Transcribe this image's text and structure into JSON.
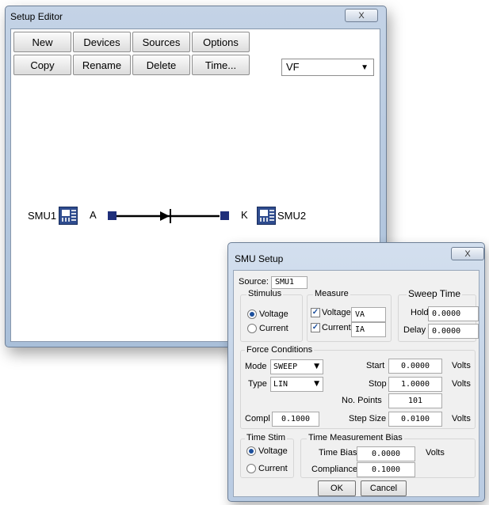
{
  "setup_editor": {
    "title": "Setup Editor",
    "close_glyph": "X",
    "toolbar_row1": [
      "New",
      "Devices",
      "Sources",
      "Options"
    ],
    "toolbar_row2": [
      "Copy",
      "Rename",
      "Delete",
      "Time..."
    ],
    "setup_select": {
      "value": "VF",
      "arrow": "▼"
    },
    "diagram": {
      "left_smu": "SMU1",
      "right_smu": "SMU2",
      "anode_label": "A",
      "cathode_label": "K"
    }
  },
  "smu_setup": {
    "title": "SMU Setup",
    "close_glyph": "X",
    "source_label": "Source:",
    "source_value": "SMU1",
    "stimulus": {
      "label": "Stimulus",
      "voltage": "Voltage",
      "current": "Current",
      "selected": "Voltage"
    },
    "measure": {
      "label": "Measure",
      "voltage": "Voltage",
      "current": "Current",
      "voltage_name": "VA",
      "current_name": "IA",
      "voltage_checked": true,
      "current_checked": true
    },
    "sweep_time": {
      "label": "Sweep Time",
      "hold_label": "Hold",
      "hold_value": "0.0000",
      "delay_label": "Delay",
      "delay_value": "0.0000"
    },
    "force": {
      "label": "Force Conditions",
      "mode_label": "Mode",
      "mode_value": "SWEEP",
      "type_label": "Type",
      "type_value": "LIN",
      "start_label": "Start",
      "start_value": "0.0000",
      "stop_label": "Stop",
      "stop_value": "1.0000",
      "points_label": "No. Points",
      "points_value": "101",
      "compl_label": "Compl",
      "compl_value": "0.1000",
      "step_label": "Step Size",
      "step_value": "0.0100",
      "volts_unit": "Volts",
      "dropdown_arrow": "▼"
    },
    "time_stim": {
      "label": "Time Stim",
      "voltage": "Voltage",
      "current": "Current",
      "selected": "Voltage"
    },
    "time_bias": {
      "label": "Time Measurement Bias",
      "bias_label": "Time Bias",
      "bias_value": "0.0000",
      "bias_unit": "Volts",
      "compliance_label": "Compliance",
      "compliance_value": "0.1000"
    },
    "ok_label": "OK",
    "cancel_label": "Cancel"
  }
}
